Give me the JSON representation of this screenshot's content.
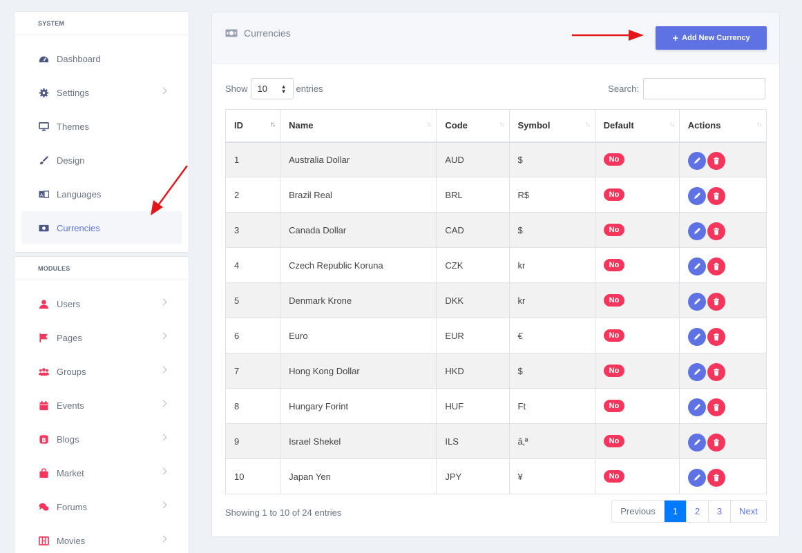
{
  "sidebar": {
    "system_header": "SYSTEM",
    "modules_header": "MODULES",
    "system_items": [
      {
        "label": "Dashboard",
        "icon": "dashboard-icon",
        "chevron": false,
        "active": false
      },
      {
        "label": "Settings",
        "icon": "gear-icon",
        "chevron": true,
        "active": false
      },
      {
        "label": "Themes",
        "icon": "monitor-icon",
        "chevron": false,
        "active": false
      },
      {
        "label": "Design",
        "icon": "brush-icon",
        "chevron": false,
        "active": false
      },
      {
        "label": "Languages",
        "icon": "language-icon",
        "chevron": false,
        "active": false
      },
      {
        "label": "Currencies",
        "icon": "money-icon",
        "chevron": false,
        "active": true
      }
    ],
    "module_items": [
      {
        "label": "Users",
        "icon": "user-icon"
      },
      {
        "label": "Pages",
        "icon": "flag-icon"
      },
      {
        "label": "Groups",
        "icon": "users-group-icon"
      },
      {
        "label": "Events",
        "icon": "calendar-icon"
      },
      {
        "label": "Blogs",
        "icon": "blog-icon"
      },
      {
        "label": "Market",
        "icon": "shopping-bag-icon"
      },
      {
        "label": "Forums",
        "icon": "comments-icon"
      },
      {
        "label": "Movies",
        "icon": "film-icon"
      }
    ]
  },
  "header": {
    "title": "Currencies",
    "add_button": "Add New Currency"
  },
  "controls": {
    "show_label": "Show",
    "entries_value": "10",
    "entries_label": "entries",
    "search_label": "Search:"
  },
  "table": {
    "columns": [
      "ID",
      "Name",
      "Code",
      "Symbol",
      "Default",
      "Actions"
    ],
    "rows": [
      {
        "id": "1",
        "name": "Australia Dollar",
        "code": "AUD",
        "symbol": "$",
        "default": "No"
      },
      {
        "id": "2",
        "name": "Brazil Real",
        "code": "BRL",
        "symbol": "R$",
        "default": "No"
      },
      {
        "id": "3",
        "name": "Canada Dollar",
        "code": "CAD",
        "symbol": "$",
        "default": "No"
      },
      {
        "id": "4",
        "name": "Czech Republic Koruna",
        "code": "CZK",
        "symbol": "kr",
        "default": "No"
      },
      {
        "id": "5",
        "name": "Denmark Krone",
        "code": "DKK",
        "symbol": "kr",
        "default": "No"
      },
      {
        "id": "6",
        "name": "Euro",
        "code": "EUR",
        "symbol": "€",
        "default": "No"
      },
      {
        "id": "7",
        "name": "Hong Kong Dollar",
        "code": "HKD",
        "symbol": "$",
        "default": "No"
      },
      {
        "id": "8",
        "name": "Hungary Forint",
        "code": "HUF",
        "symbol": "Ft",
        "default": "No"
      },
      {
        "id": "9",
        "name": "Israel Shekel",
        "code": "ILS",
        "symbol": "â‚ª",
        "default": "No"
      },
      {
        "id": "10",
        "name": "Japan Yen",
        "code": "JPY",
        "symbol": "¥",
        "default": "No"
      }
    ]
  },
  "footer": {
    "info": "Showing 1 to 10 of 24 entries",
    "previous": "Previous",
    "pages": [
      "1",
      "2",
      "3"
    ],
    "current_page": "1",
    "next": "Next"
  },
  "colors": {
    "primary": "#5e72e4",
    "danger": "#f5365c",
    "sidebar_system_icon": "#4a5683",
    "sidebar_module_icon": "#f5365c",
    "annotation_arrow": "#e3161b"
  }
}
